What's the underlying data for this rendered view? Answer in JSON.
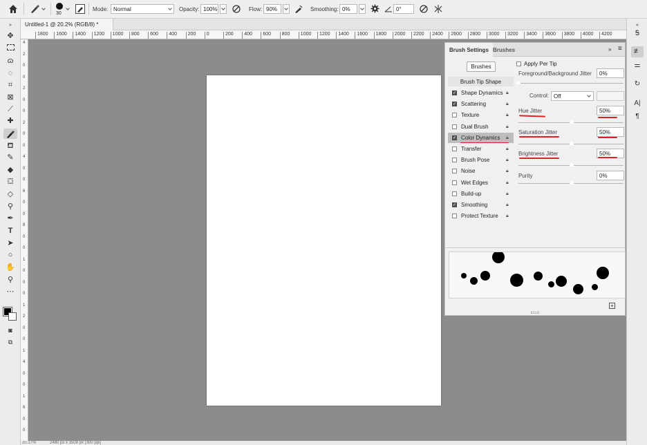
{
  "options_bar": {
    "brush_size": "30",
    "mode_label": "Mode:",
    "mode_value": "Normal",
    "opacity_label": "Opacity:",
    "opacity_value": "100%",
    "flow_label": "Flow:",
    "flow_value": "90%",
    "smoothing_label": "Smoothing:",
    "smoothing_value": "0%",
    "angle_value": "0°"
  },
  "document_tab": {
    "title": "Untitled-1 @ 20.2% (RGB/8) *"
  },
  "ruler": {
    "h_ticks": [
      "1800",
      "1600",
      "1400",
      "1200",
      "1000",
      "800",
      "600",
      "400",
      "200",
      "0",
      "200",
      "400",
      "600",
      "800",
      "1000",
      "1200",
      "1400",
      "1600",
      "1800",
      "2000",
      "2200",
      "2400",
      "2600",
      "2800",
      "3000",
      "3200",
      "3400",
      "3600",
      "3800",
      "4000",
      "4200"
    ]
  },
  "status_bar": {
    "zoom": "20.17%",
    "doc_size": "2480 px x 3508 px (300 ppi)"
  },
  "brush_settings_panel": {
    "tab_active": "Brush Settings",
    "tab_other": "Brushes",
    "brushes_button": "Brushes",
    "section_header": "Brush Tip Shape",
    "options": [
      {
        "label": "Shape Dynamics",
        "checked": true
      },
      {
        "label": "Scattering",
        "checked": true
      },
      {
        "label": "Texture",
        "checked": false
      },
      {
        "label": "Dual Brush",
        "checked": false
      },
      {
        "label": "Color Dynamics",
        "checked": true,
        "selected": true
      },
      {
        "label": "Transfer",
        "checked": false
      },
      {
        "label": "Brush Pose",
        "checked": false
      },
      {
        "label": "Noise",
        "checked": false
      },
      {
        "label": "Wet Edges",
        "checked": false
      },
      {
        "label": "Build-up",
        "checked": false
      },
      {
        "label": "Smoothing",
        "checked": true
      },
      {
        "label": "Protect Texture",
        "checked": false
      }
    ],
    "apply_per_tip": "Apply Per Tip",
    "fg_bg_jitter_label": "Foreground/Background Jitter",
    "fg_bg_jitter_value": "0%",
    "control_label": "Control:",
    "control_value": "Off",
    "hue_jitter_label": "Hue Jitter",
    "hue_jitter_value": "50%",
    "saturation_jitter_label": "Saturation Jitter",
    "saturation_jitter_value": "50%",
    "brightness_jitter_label": "Brightness Jitter",
    "brightness_jitter_value": "50%",
    "purity_label": "Purity",
    "purity_value": "0%"
  },
  "colors": {
    "workspace": "#8c8c8c",
    "annotation_red": "#d22222"
  }
}
